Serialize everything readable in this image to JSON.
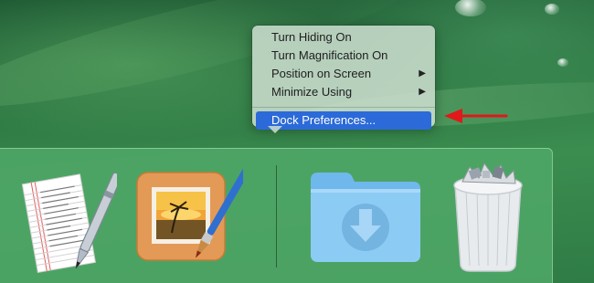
{
  "context_menu": {
    "items": [
      {
        "label": "Turn Hiding On",
        "has_submenu": false
      },
      {
        "label": "Turn Magnification On",
        "has_submenu": false
      },
      {
        "label": "Position on Screen",
        "has_submenu": true
      },
      {
        "label": "Minimize Using",
        "has_submenu": true
      }
    ],
    "highlighted_item": {
      "label": "Dock Preferences..."
    },
    "submenu_arrow": "▶"
  },
  "dock": {
    "apps": [
      {
        "name": "TextEdit",
        "icon": "textedit-icon"
      },
      {
        "name": "Pixelmator",
        "icon": "pixelmator-icon"
      },
      {
        "name": "Downloads",
        "icon": "downloads-folder-icon"
      },
      {
        "name": "Trash",
        "icon": "trash-icon"
      }
    ]
  },
  "colors": {
    "menu_highlight": "#2b6ad8",
    "pointer_arrow": "#e0191b",
    "dock_background": "#50aa69"
  }
}
